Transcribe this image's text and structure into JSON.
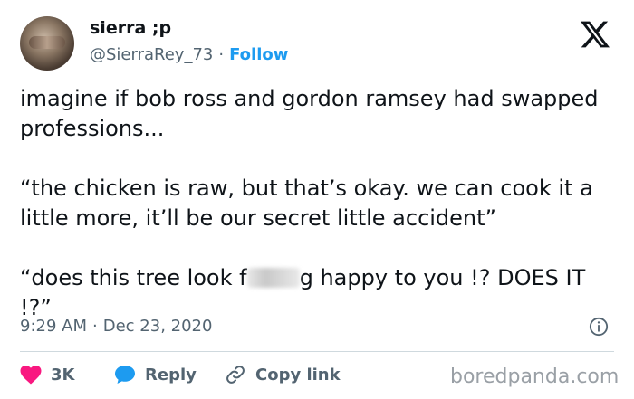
{
  "user": {
    "display_name": "sierra ;p",
    "handle": "@SierraRey_73",
    "separator": "·",
    "follow_label": "Follow"
  },
  "tweet": {
    "line1": "imagine if bob ross and gordon ramsey had swapped professions...",
    "quote1": "“the chicken is raw, but that’s okay. we can cook it a little more, it’ll be our secret little accident”",
    "quote2_start": "“does this tree look f",
    "quote2_end": "g happy to you !? DOES IT !?”"
  },
  "meta": {
    "time": "9:29 AM",
    "separator": "·",
    "date": "Dec 23, 2020"
  },
  "actions": {
    "like_count": "3K",
    "reply_label": "Reply",
    "copy_link_label": "Copy link"
  },
  "watermark": "boredpanda.com",
  "colors": {
    "like": "#f91880",
    "reply": "#1d9bf0",
    "follow": "#1d9bf0",
    "muted": "#536471"
  },
  "icons": [
    "x-logo-icon",
    "heart-icon",
    "reply-bubble-icon",
    "link-icon",
    "info-icon"
  ]
}
